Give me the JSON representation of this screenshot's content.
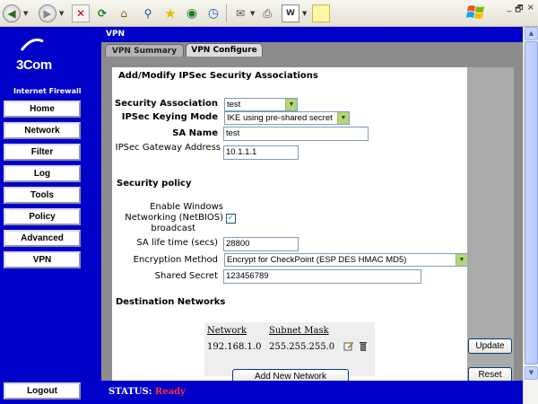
{
  "browser": {
    "winctl": {
      "minimize": "_",
      "restore": "🗗",
      "close": "×"
    }
  },
  "nav": {
    "brand": "3Com",
    "product": "Internet Firewall",
    "items": [
      {
        "label": "Home"
      },
      {
        "label": "Network"
      },
      {
        "label": "Filter"
      },
      {
        "label": "Log"
      },
      {
        "label": "Tools"
      },
      {
        "label": "Policy"
      },
      {
        "label": "Advanced"
      },
      {
        "label": "VPN"
      }
    ],
    "logout": "Logout"
  },
  "main": {
    "title": "VPN",
    "tabs": [
      {
        "label": "VPN Summary",
        "active": false
      },
      {
        "label": "VPN Configure",
        "active": true
      }
    ],
    "section_title": "Add/Modify IPSec Security Associations",
    "form": {
      "sa_label": "Security Association",
      "sa_value": "test",
      "keying_label": "IPSec Keying Mode",
      "keying_value": "IKE using pre-shared secret",
      "sa_name_label": "SA Name",
      "sa_name_value": "test",
      "gateway_label": "IPSec Gateway Address",
      "gateway_value": "10.1.1.1"
    },
    "security_policy": {
      "heading": "Security policy",
      "netbios_label_1": "Enable Windows",
      "netbios_label_2": "Networking (NetBIOS)",
      "netbios_label_3": "broadcast",
      "netbios_checked": true,
      "lifetime_label": "SA life time (secs)",
      "lifetime_value": "28800",
      "encryption_label": "Encryption Method",
      "encryption_value": "Encrypt for CheckPoint (ESP DES HMAC MD5)",
      "secret_label": "Shared Secret",
      "secret_value": "123456789"
    },
    "destination": {
      "heading": "Destination Networks",
      "columns": [
        "Network",
        "Subnet Mask"
      ],
      "rows": [
        {
          "network": "192.168.1.0",
          "mask": "255.255.255.0"
        }
      ],
      "add_button": "Add New Network"
    },
    "update_button": "Update",
    "reset_button": "Reset"
  },
  "status": {
    "label": "STATUS:",
    "value": "Ready"
  }
}
